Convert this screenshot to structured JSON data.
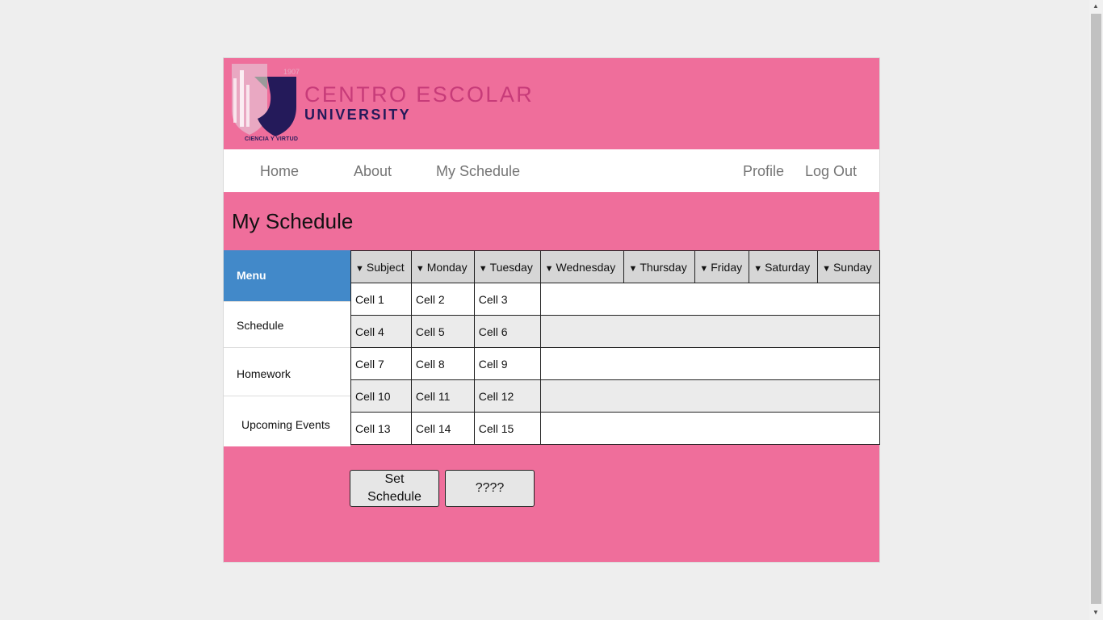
{
  "header": {
    "logo_year": "1907",
    "logo_motto": "CIENCIA Y VIRTUD",
    "brand_line1": "CENTRO ESCOLAR",
    "brand_line2": "UNIVERSITY"
  },
  "nav": {
    "home": "Home",
    "about": "About",
    "my_schedule": "My Schedule",
    "profile": "Profile",
    "logout": "Log Out"
  },
  "page_title": "My Schedule",
  "menu": {
    "header": "Menu",
    "items": [
      "Schedule",
      "Homework",
      "Upcoming Events"
    ]
  },
  "table": {
    "arrow": "▼",
    "headers": [
      "Subject",
      "Monday",
      "Tuesday",
      "Wednesday",
      "Thursday",
      "Friday",
      "Saturday",
      "Sunday"
    ],
    "rows": [
      [
        "Cell 1",
        "Cell 2",
        "Cell 3"
      ],
      [
        "Cell 4",
        "Cell 5",
        "Cell 6"
      ],
      [
        "Cell 7",
        "Cell 8",
        "Cell 9"
      ],
      [
        "Cell 10",
        "Cell 11",
        "Cell 12"
      ],
      [
        "Cell 13",
        "Cell 14",
        "Cell 15"
      ]
    ]
  },
  "buttons": {
    "set_schedule": "Set Schedule",
    "unknown": "????"
  },
  "colors": {
    "page_bg": "#ef6e9b",
    "menu_header": "#4289c9",
    "header_cell": "#d6d6d6",
    "row_alt": "#ebebeb"
  },
  "icons": {
    "sort": "chevron-down-icon",
    "logo": "university-crest-icon"
  }
}
